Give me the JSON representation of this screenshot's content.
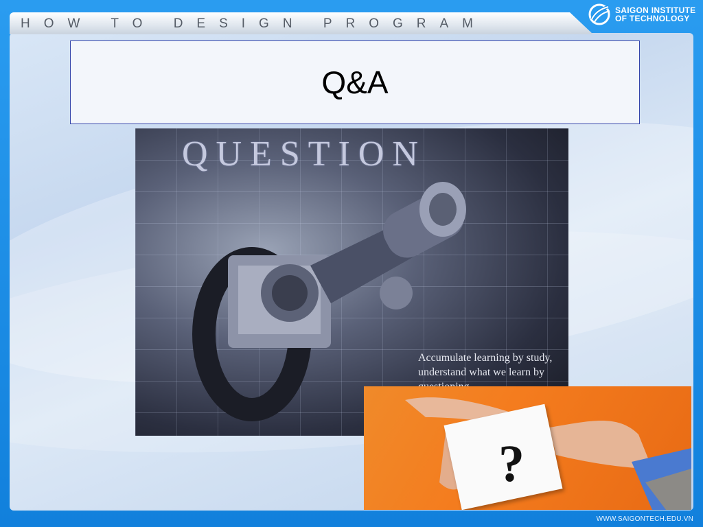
{
  "header": {
    "course_title": "HOW TO DESIGN PROGRAM"
  },
  "logo": {
    "line1": "SAIGON INSTITUTE",
    "line2": "OF TECHNOLOGY"
  },
  "slide": {
    "title": "Q&A"
  },
  "image_main": {
    "heading": "QUESTION",
    "caption": "Accumulate learning by study, understand what we learn by questioning",
    "icon": "microscope-illustration"
  },
  "image_card": {
    "symbol": "?",
    "icon": "hand-holding-question-card"
  },
  "footer": {
    "url": "WWW.SAIGONTECH.EDU.VN"
  },
  "colors": {
    "frame": "#1e8fe6",
    "title_border": "#3344aa",
    "card_bg": "#f47c1e"
  }
}
